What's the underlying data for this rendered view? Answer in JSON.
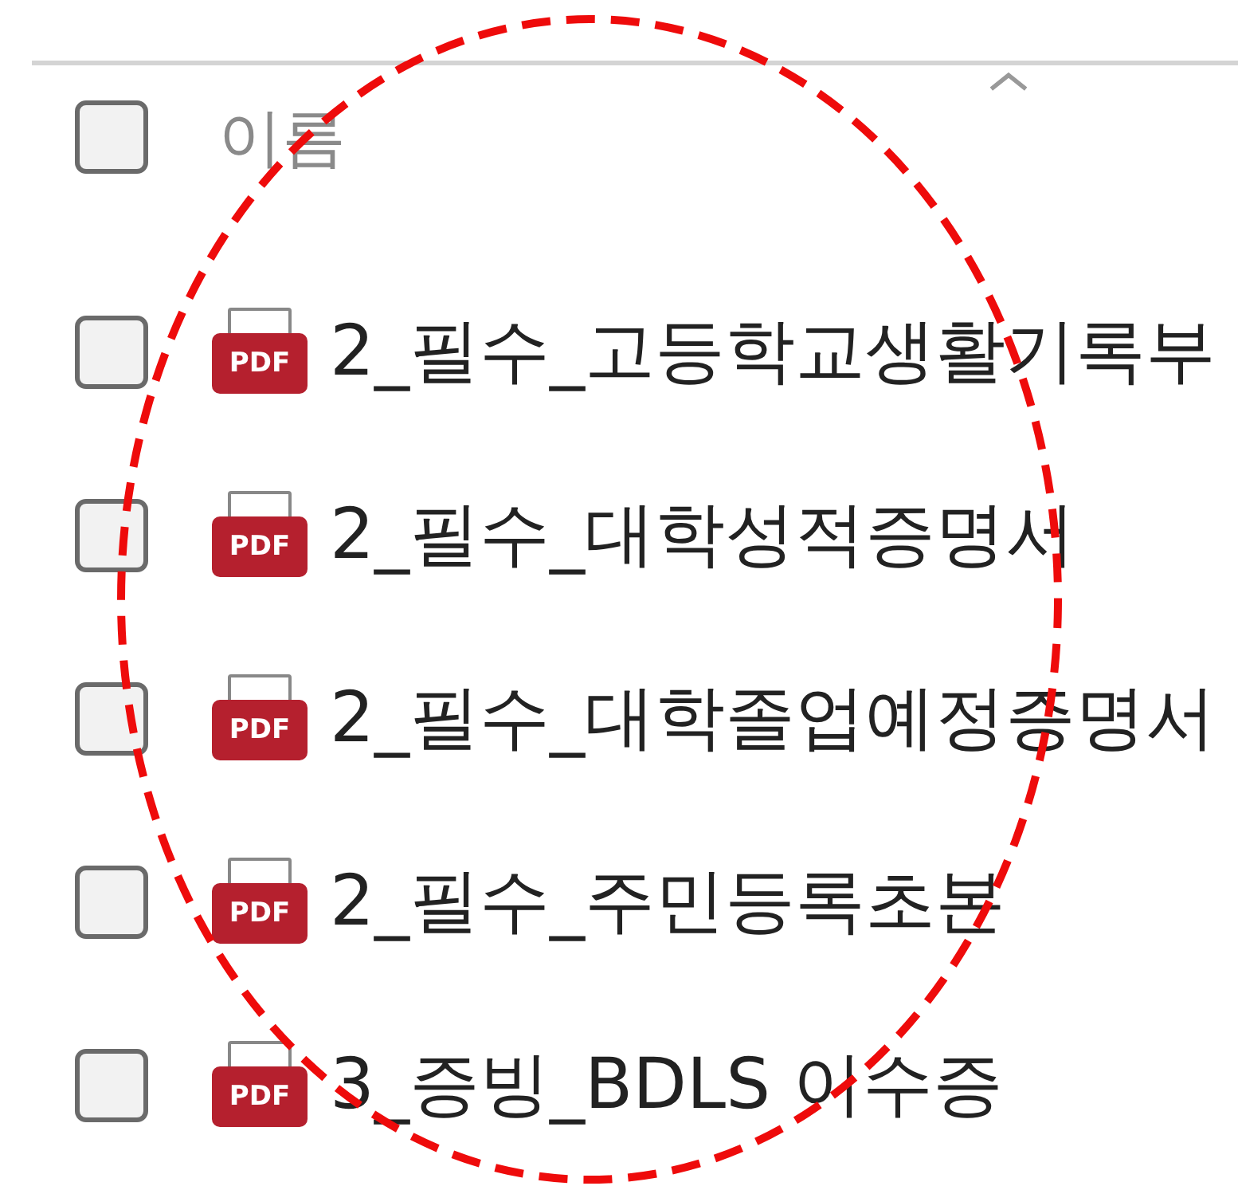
{
  "header": {
    "label": "이름",
    "checked": false,
    "sort_ascending": true
  },
  "files": [
    {
      "name": "2_필수_고등학교생활기록부",
      "icon_label": "PDF",
      "checked": false
    },
    {
      "name": "2_필수_대학성적증명서",
      "icon_label": "PDF",
      "checked": false
    },
    {
      "name": "2_필수_대학졸업예정증명서",
      "icon_label": "PDF",
      "checked": false
    },
    {
      "name": "2_필수_주민등록초본",
      "icon_label": "PDF",
      "checked": false
    },
    {
      "name": "3_증빙_BDLS 이수증",
      "icon_label": "PDF",
      "checked": false
    }
  ],
  "annotation": {
    "kind": "dashed-ellipse"
  }
}
